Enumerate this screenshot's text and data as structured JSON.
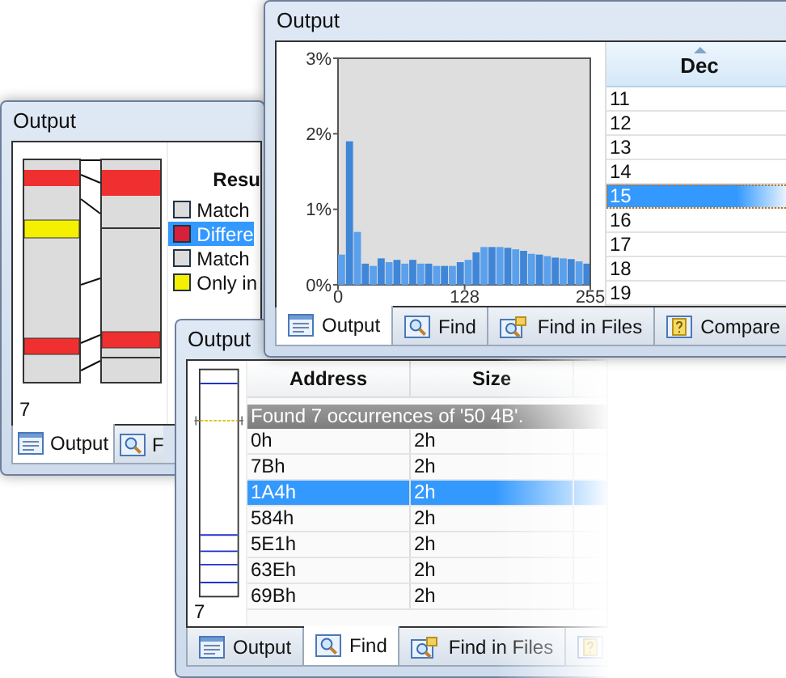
{
  "windows": [
    {
      "kind": "compare",
      "title": "Output",
      "list_header": "Resu",
      "legend": [
        {
          "label": "Match",
          "color": "#dcdcdc",
          "selected": false
        },
        {
          "label": "Differe",
          "color": "#d8203a",
          "selected": true
        },
        {
          "label": "Match",
          "color": "#dcdcdc",
          "selected": false
        },
        {
          "label": "Only in",
          "color": "#f4f000",
          "selected": false
        }
      ],
      "count": "7",
      "tabs": [
        {
          "kind": "output",
          "label": "Output",
          "selected": true
        },
        {
          "kind": "find",
          "label": "F",
          "selected": false
        }
      ]
    },
    {
      "kind": "histogram",
      "title": "Output",
      "chart_data": {
        "type": "bar",
        "x": [
          0,
          8,
          16,
          24,
          32,
          40,
          48,
          56,
          64,
          72,
          80,
          88,
          96,
          104,
          112,
          120,
          128,
          136,
          144,
          152,
          160,
          168,
          176,
          184,
          192,
          200,
          208,
          216,
          224,
          232,
          240,
          248
        ],
        "values": [
          0.4,
          1.9,
          0.7,
          0.28,
          0.25,
          0.35,
          0.3,
          0.33,
          0.28,
          0.33,
          0.28,
          0.28,
          0.25,
          0.25,
          0.25,
          0.3,
          0.33,
          0.43,
          0.5,
          0.5,
          0.5,
          0.49,
          0.47,
          0.45,
          0.41,
          0.4,
          0.38,
          0.36,
          0.35,
          0.34,
          0.31,
          0.28
        ],
        "xlim": [
          0,
          255
        ],
        "ylim": [
          0,
          3
        ],
        "xticks": [
          0,
          128,
          255
        ],
        "yticks": [
          {
            "value": 0,
            "label": "0%"
          },
          {
            "value": 1,
            "label": "1%"
          },
          {
            "value": 2,
            "label": "2%"
          },
          {
            "value": 3,
            "label": "3%"
          }
        ]
      },
      "table": {
        "column": "Dec",
        "rows": [
          {
            "value": "11",
            "selected": false
          },
          {
            "value": "12",
            "selected": false
          },
          {
            "value": "13",
            "selected": false
          },
          {
            "value": "14",
            "selected": false
          },
          {
            "value": "15",
            "selected": true
          },
          {
            "value": "16",
            "selected": false
          },
          {
            "value": "17",
            "selected": false
          },
          {
            "value": "18",
            "selected": false
          },
          {
            "value": "19",
            "selected": false
          }
        ]
      },
      "tabs": [
        {
          "kind": "output",
          "label": "Output",
          "selected": true
        },
        {
          "kind": "find",
          "label": "Find",
          "selected": false
        },
        {
          "kind": "files",
          "label": "Find in Files",
          "selected": false
        },
        {
          "kind": "compare",
          "label": "Compare",
          "selected": false
        }
      ]
    },
    {
      "kind": "find",
      "title": "Output",
      "columns": [
        "Address",
        "Size"
      ],
      "group": "Found 7 occurrences of '50 4B'.",
      "rows": [
        {
          "address": "0h",
          "size": "2h",
          "selected": false
        },
        {
          "address": "7Bh",
          "size": "2h",
          "selected": false
        },
        {
          "address": "1A4h",
          "size": "2h",
          "selected": true
        },
        {
          "address": "584h",
          "size": "2h",
          "selected": false
        },
        {
          "address": "5E1h",
          "size": "2h",
          "selected": false
        },
        {
          "address": "63Eh",
          "size": "2h",
          "selected": false
        },
        {
          "address": "69Bh",
          "size": "2h",
          "selected": false
        }
      ],
      "count": "7",
      "tabs": [
        {
          "kind": "output",
          "label": "Output",
          "selected": false
        },
        {
          "kind": "find",
          "label": "Find",
          "selected": true
        },
        {
          "kind": "files",
          "label": "Find in Files",
          "selected": false
        },
        {
          "kind": "compare",
          "selected": false
        }
      ]
    }
  ]
}
